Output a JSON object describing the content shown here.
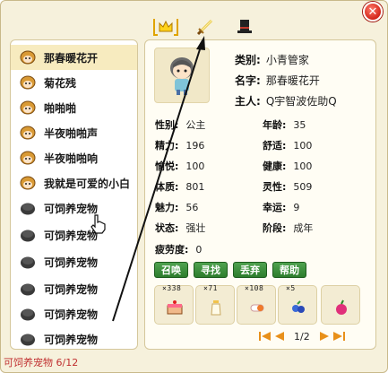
{
  "list": {
    "items": [
      {
        "name": "那春暖花开",
        "type": "pet",
        "selected": true
      },
      {
        "name": "菊花残",
        "type": "pet"
      },
      {
        "name": "啪啪啪",
        "type": "pet"
      },
      {
        "name": "半夜啪啪声",
        "type": "pet"
      },
      {
        "name": "半夜啪啪响",
        "type": "pet"
      },
      {
        "name": "我就是可爱的小白",
        "type": "pet"
      },
      {
        "name": "可饲养宠物",
        "type": "empty"
      },
      {
        "name": "可饲养宠物",
        "type": "empty"
      },
      {
        "name": "可饲养宠物",
        "type": "empty"
      },
      {
        "name": "可饲养宠物",
        "type": "empty"
      },
      {
        "name": "可饲养宠物",
        "type": "empty"
      },
      {
        "name": "可饲养宠物",
        "type": "empty"
      }
    ],
    "footer": "可饲养宠物 6/12"
  },
  "tabs": [
    {
      "icon": "crown-icon"
    },
    {
      "icon": "sword-icon"
    },
    {
      "icon": "top-hat-icon"
    }
  ],
  "profile": {
    "category_label": "类别:",
    "category": "小青管家",
    "name_label": "名字:",
    "name": "那春暖花开",
    "owner_label": "主人:",
    "owner": "Q宇智波佐助Q"
  },
  "stats": {
    "gender_label": "性别:",
    "gender": "公主",
    "age_label": "年龄:",
    "age": "35",
    "energy_label": "精力:",
    "energy": "196",
    "comfort_label": "舒适:",
    "comfort": "100",
    "joy_label": "愉悦:",
    "joy": "100",
    "health_label": "健康:",
    "health": "100",
    "physique_label": "体质:",
    "physique": "801",
    "spirit_label": "灵性:",
    "spirit": "509",
    "charm_label": "魅力:",
    "charm": "56",
    "luck_label": "幸运:",
    "luck": "9",
    "status_label": "状态:",
    "status": "强壮",
    "stage_label": "阶段:",
    "stage": "成年",
    "fatigue_label": "疲劳度:",
    "fatigue": "0"
  },
  "actions": {
    "summon": "召唤",
    "find": "寻找",
    "discard": "丢弃",
    "help": "帮助"
  },
  "inventory": [
    {
      "count": "×338",
      "icon": "cake-icon"
    },
    {
      "count": "×71",
      "icon": "milk-bottle-icon"
    },
    {
      "count": "×108",
      "icon": "pill-icon"
    },
    {
      "count": "×5",
      "icon": "berries-icon"
    },
    {
      "count": "",
      "icon": "apple-icon"
    }
  ],
  "pagination": {
    "text": "1/2"
  },
  "colors": {
    "accent_green": "#2d7d2d",
    "close_red": "#d3261a",
    "footer_red": "#c03030",
    "panel_bg": "#f6f1dc"
  }
}
